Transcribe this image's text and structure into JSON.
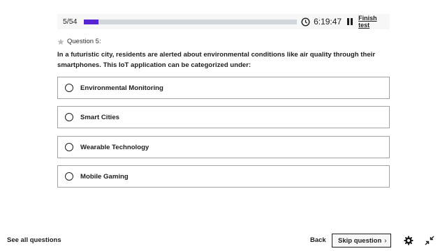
{
  "header": {
    "progress_text": "5/54",
    "progress_fraction": 0.07,
    "timer": "6:19:47",
    "finish_label": "Finish test",
    "accent_color": "#5624d0"
  },
  "question": {
    "label": "Question 5:",
    "text": "In a futuristic city, residents are alerted about environmental conditions like air quality through their smartphones. This IoT application can be categorized under:",
    "options": [
      {
        "label": "Environmental Monitoring"
      },
      {
        "label": "Smart Cities"
      },
      {
        "label": "Wearable Technology"
      },
      {
        "label": "Mobile Gaming"
      }
    ]
  },
  "footer": {
    "see_all": "See all questions",
    "back": "Back",
    "skip": "Skip question",
    "icons": [
      "gear-icon",
      "collapse-icon"
    ]
  }
}
